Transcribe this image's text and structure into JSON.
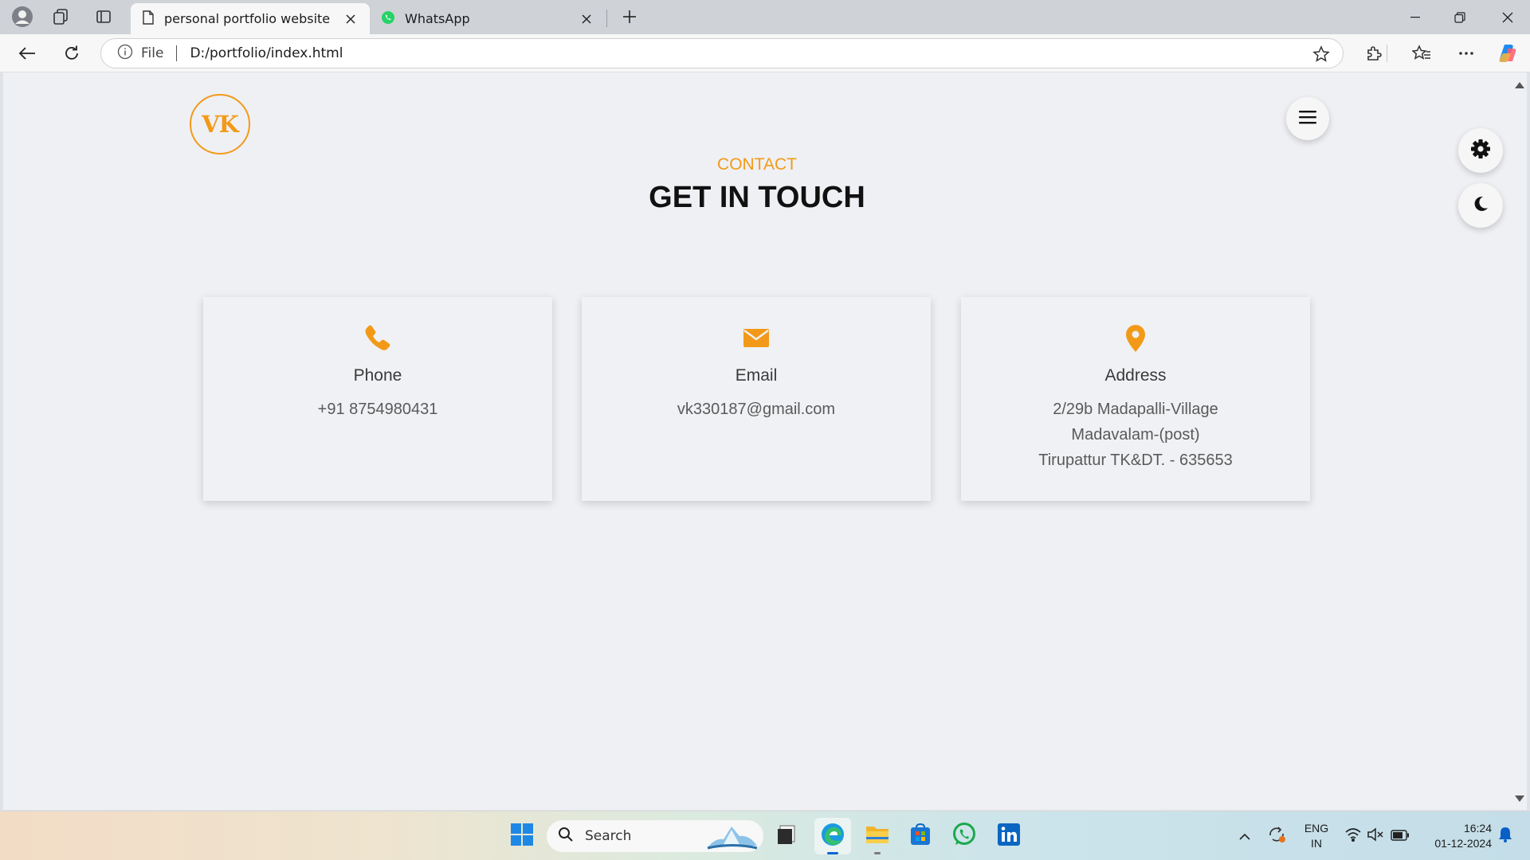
{
  "browser": {
    "tabs": [
      {
        "title": "personal portfolio website",
        "icon": "page-icon",
        "active": true
      },
      {
        "title": "WhatsApp",
        "icon": "whatsapp-icon",
        "active": false
      }
    ],
    "address": {
      "scheme_label": "File",
      "url": "D:/portfolio/index.html"
    }
  },
  "page": {
    "logo_text": "VK",
    "section_subtitle": "CONTACT",
    "section_title": "GET IN TOUCH",
    "accent_color": "#f29a18",
    "cards": [
      {
        "icon": "phone-icon",
        "title": "Phone",
        "lines": [
          "+91 8754980431"
        ]
      },
      {
        "icon": "envelope-icon",
        "title": "Email",
        "lines": [
          "vk330187@gmail.com"
        ]
      },
      {
        "icon": "map-pin-icon",
        "title": "Address",
        "lines": [
          "2/29b Madapalli-Village",
          "Madavalam-(post)",
          "Tirupattur TK&DT. - 635653"
        ]
      }
    ]
  },
  "taskbar": {
    "search_placeholder": "Search",
    "language": {
      "line1": "ENG",
      "line2": "IN"
    },
    "clock": {
      "time": "16:24",
      "date": "01-12-2024"
    }
  }
}
